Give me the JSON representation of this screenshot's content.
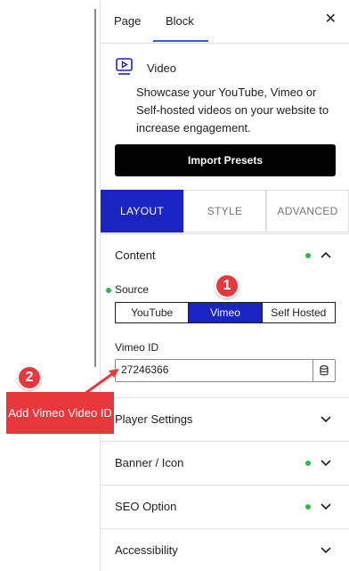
{
  "sidebar_tabs": {
    "page": "Page",
    "block": "Block"
  },
  "block": {
    "title": "Video",
    "description": "Showcase your YouTube, Vimeo or Self-hosted videos on your website to increase engagement.",
    "import_presets": "Import Presets"
  },
  "panel_tabs": {
    "layout": "LAYOUT",
    "style": "STYLE",
    "advanced": "ADVANCED"
  },
  "content": {
    "title": "Content",
    "source_label": "Source",
    "source_options": [
      "YouTube",
      "Vimeo",
      "Self Hosted"
    ],
    "selected_source": "Vimeo",
    "vimeo_id_label": "Vimeo ID",
    "vimeo_id_value": "27246366"
  },
  "sections": {
    "player_settings": "Player Settings",
    "banner_icon": "Banner / Icon",
    "seo_option": "SEO Option",
    "accessibility": "Accessibility"
  },
  "annotations": {
    "step1": "1",
    "step2": "2",
    "callout": "Add Vimeo Video ID"
  },
  "colors": {
    "accent": "#1a23c4",
    "status_dot": "#2fb64a",
    "annotation": "#e8383d",
    "tab_underline": "#3858e9"
  }
}
